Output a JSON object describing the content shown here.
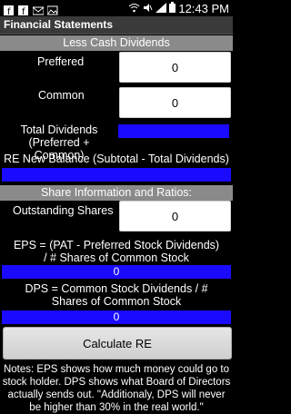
{
  "status_bar": {
    "time": "12:43 PM",
    "icons": [
      "facebook-icon",
      "facebook-icon",
      "mail-icon",
      "image-icon",
      "wifi-icon",
      "mute-icon",
      "signal-icon",
      "battery-icon"
    ]
  },
  "app": {
    "title": "Financial Statements"
  },
  "section_dividends": {
    "header": "Less Cash Dividends",
    "preferred_label": "Preffered",
    "preferred_value": "0",
    "common_label": "Common",
    "common_value": "0",
    "total_label": "Total Dividends\n(Preferred + Common)",
    "total_value": "",
    "re_label": "RE New Balance (Subtotal - Total Dividends)",
    "re_value": ""
  },
  "section_shares": {
    "header": "Share Information and Ratios:",
    "outstanding_label": "Outstanding Shares",
    "outstanding_value": "0",
    "eps_label": "EPS = (PAT - Preferred Stock Dividends) / # Shares of Common Stock",
    "eps_value": "0",
    "dps_label": "DPS = Common Stock Dividends / # Shares of Common Stock",
    "dps_value": "0"
  },
  "button": {
    "calculate_label": "Calculate RE"
  },
  "notes": "Notes: EPS shows how much money could go to stock holder. DPS shows what Board of Directors actually sends out. \"Additionaly, DPS will never be higher than 30% in the real world.\"",
  "colors": {
    "accent_blue": "#1a0aff",
    "section_header_gray": "#8a8a8a",
    "background": "#000000"
  }
}
